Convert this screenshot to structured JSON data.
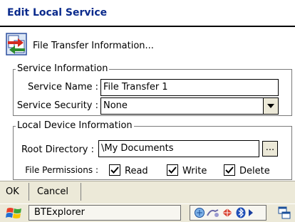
{
  "window": {
    "title": "Edit Local Service"
  },
  "header": {
    "text": "File Transfer Information...",
    "icon": "file-transfer-icon"
  },
  "service_info": {
    "legend": "Service Information",
    "name_label": "Service Name :",
    "name_value": "File Transfer 1",
    "security_label": "Service Security :",
    "security_value": "None"
  },
  "device_info": {
    "legend": "Local Device Information",
    "root_label": "Root Directory :",
    "root_value": "\\My Documents",
    "browse_label": "...",
    "perm_label": "File Permissions :",
    "perms": [
      {
        "label": "Read",
        "checked": true
      },
      {
        "label": "Write",
        "checked": true
      },
      {
        "label": "Delete",
        "checked": true
      }
    ]
  },
  "menubar": {
    "ok": "OK",
    "cancel": "Cancel"
  },
  "taskbar": {
    "app": "BTExplorer"
  },
  "colors": {
    "title": "#0a2a8c",
    "chrome": "#ece9d8"
  }
}
